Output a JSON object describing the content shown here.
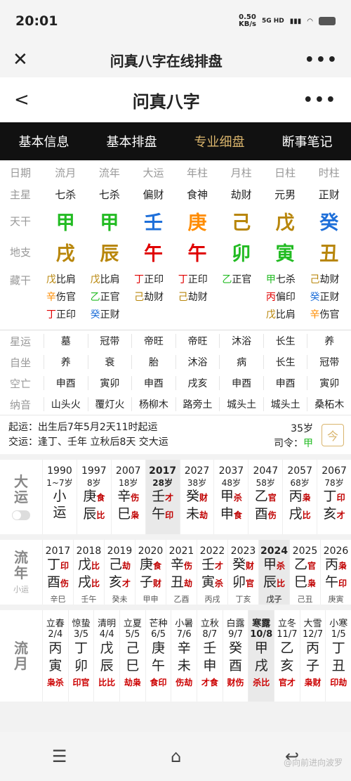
{
  "status": {
    "time": "20:01",
    "speed": "0.50",
    "speed_unit": "KB/s",
    "network": "5G HD"
  },
  "browser": {
    "title": "问真八字在线排盘"
  },
  "app": {
    "title": "问真八字"
  },
  "tabs": [
    {
      "label": "基本信息"
    },
    {
      "label": "基本排盘"
    },
    {
      "label": "专业细盘"
    },
    {
      "label": "断事笔记"
    }
  ],
  "colors": {
    "wood": "#22bb22",
    "fire": "#e00000",
    "earth": "#b8860b",
    "metal": "#ff8c00",
    "water": "#1e6fd9",
    "tag": "#c00000",
    "accent": "#d9b46c"
  },
  "chart": {
    "headers": {
      "label": "日期",
      "cols": [
        "流月",
        "流年",
        "大运",
        "年柱",
        "月柱",
        "日柱",
        "时柱"
      ]
    },
    "stars": {
      "label": "主星",
      "cols": [
        "七杀",
        "七杀",
        "偏财",
        "食神",
        "劫财",
        "元男",
        "正财"
      ]
    },
    "tiangan": {
      "label": "天干",
      "cols": [
        {
          "t": "甲",
          "c": "#22bb22"
        },
        {
          "t": "甲",
          "c": "#22bb22"
        },
        {
          "t": "壬",
          "c": "#1e6fd9"
        },
        {
          "t": "庚",
          "c": "#ff8c00"
        },
        {
          "t": "己",
          "c": "#b8860b"
        },
        {
          "t": "戊",
          "c": "#b8860b"
        },
        {
          "t": "癸",
          "c": "#1e6fd9"
        }
      ]
    },
    "dizhi": {
      "label": "地支",
      "cols": [
        {
          "t": "戌",
          "c": "#b8860b"
        },
        {
          "t": "辰",
          "c": "#b8860b"
        },
        {
          "t": "午",
          "c": "#e00000"
        },
        {
          "t": "午",
          "c": "#e00000"
        },
        {
          "t": "卯",
          "c": "#22bb22"
        },
        {
          "t": "寅",
          "c": "#22bb22"
        },
        {
          "t": "丑",
          "c": "#b8860b"
        }
      ]
    },
    "canggan": {
      "label": "藏干",
      "cols": [
        [
          {
            "g": "戊",
            "c": "#b8860b",
            "s": "比肩"
          },
          {
            "g": "辛",
            "c": "#ff8c00",
            "s": "伤官"
          },
          {
            "g": "丁",
            "c": "#e00000",
            "s": "正印"
          }
        ],
        [
          {
            "g": "戊",
            "c": "#b8860b",
            "s": "比肩"
          },
          {
            "g": "乙",
            "c": "#22bb22",
            "s": "正官"
          },
          {
            "g": "癸",
            "c": "#1e6fd9",
            "s": "正财"
          }
        ],
        [
          {
            "g": "丁",
            "c": "#e00000",
            "s": "正印"
          },
          {
            "g": "己",
            "c": "#b8860b",
            "s": "劫财"
          }
        ],
        [
          {
            "g": "丁",
            "c": "#e00000",
            "s": "正印"
          },
          {
            "g": "己",
            "c": "#b8860b",
            "s": "劫财"
          }
        ],
        [
          {
            "g": "乙",
            "c": "#22bb22",
            "s": "正官"
          }
        ],
        [
          {
            "g": "甲",
            "c": "#22bb22",
            "s": "七杀"
          },
          {
            "g": "丙",
            "c": "#e00000",
            "s": "偏印"
          },
          {
            "g": "戊",
            "c": "#b8860b",
            "s": "比肩"
          }
        ],
        [
          {
            "g": "己",
            "c": "#b8860b",
            "s": "劫财"
          },
          {
            "g": "癸",
            "c": "#1e6fd9",
            "s": "正财"
          },
          {
            "g": "辛",
            "c": "#ff8c00",
            "s": "伤官"
          }
        ]
      ]
    },
    "xingyun": {
      "label": "星运",
      "cols": [
        "墓",
        "冠带",
        "帝旺",
        "帝旺",
        "沐浴",
        "长生",
        "养"
      ]
    },
    "zizuo": {
      "label": "自坐",
      "cols": [
        "养",
        "衰",
        "胎",
        "沐浴",
        "病",
        "长生",
        "冠带"
      ]
    },
    "kongwang": {
      "label": "空亡",
      "cols": [
        "申酉",
        "寅卯",
        "申酉",
        "戌亥",
        "申酉",
        "申酉",
        "寅卯"
      ]
    },
    "nayin": {
      "label": "纳音",
      "cols": [
        "山头火",
        "覆灯火",
        "杨柳木",
        "路旁土",
        "城头土",
        "城头土",
        "桑柘木"
      ]
    }
  },
  "qiyun": {
    "line1": "起运：出生后7年5月2天11时起运",
    "line2": "交运：逢丁、壬年 立秋后8天 交大运",
    "age": "35岁",
    "siling_label": "司令：",
    "siling_value": "甲",
    "cal_icon": "今"
  },
  "dayun": {
    "label1": "大",
    "label2": "运",
    "items": [
      {
        "year": "1990",
        "age": "1~7岁",
        "xiao": [
          "小",
          "运"
        ]
      },
      {
        "year": "1997",
        "age": "8岁",
        "g": "庚",
        "gt": "食",
        "z": "辰",
        "zt": "比"
      },
      {
        "year": "2007",
        "age": "18岁",
        "g": "辛",
        "gt": "伤",
        "z": "巳",
        "zt": "枭"
      },
      {
        "year": "2017",
        "age": "28岁",
        "g": "壬",
        "gt": "才",
        "z": "午",
        "zt": "印",
        "hl": true
      },
      {
        "year": "2027",
        "age": "38岁",
        "g": "癸",
        "gt": "财",
        "z": "未",
        "zt": "劫"
      },
      {
        "year": "2037",
        "age": "48岁",
        "g": "甲",
        "gt": "杀",
        "z": "申",
        "zt": "食"
      },
      {
        "year": "2047",
        "age": "58岁",
        "g": "乙",
        "gt": "官",
        "z": "酉",
        "zt": "伤"
      },
      {
        "year": "2057",
        "age": "68岁",
        "g": "丙",
        "gt": "枭",
        "z": "戌",
        "zt": "比"
      },
      {
        "year": "2067",
        "age": "78岁",
        "g": "丁",
        "gt": "印",
        "z": "亥",
        "zt": "才"
      }
    ]
  },
  "liunian": {
    "label1": "流",
    "label2": "年",
    "sub": "小运",
    "items": [
      {
        "year": "2017",
        "g": "丁",
        "gt": "印",
        "z": "酉",
        "zt": "伤",
        "xy": "辛巳"
      },
      {
        "year": "2018",
        "g": "戊",
        "gt": "比",
        "z": "戌",
        "zt": "比",
        "xy": "壬午"
      },
      {
        "year": "2019",
        "g": "己",
        "gt": "劫",
        "z": "亥",
        "zt": "才",
        "xy": "癸未"
      },
      {
        "year": "2020",
        "g": "庚",
        "gt": "食",
        "z": "子",
        "zt": "财",
        "xy": "甲申"
      },
      {
        "year": "2021",
        "g": "辛",
        "gt": "伤",
        "z": "丑",
        "zt": "劫",
        "xy": "乙酉"
      },
      {
        "year": "2022",
        "g": "壬",
        "gt": "才",
        "z": "寅",
        "zt": "杀",
        "xy": "丙戌"
      },
      {
        "year": "2023",
        "g": "癸",
        "gt": "财",
        "z": "卯",
        "zt": "官",
        "xy": "丁亥"
      },
      {
        "year": "2024",
        "g": "甲",
        "gt": "杀",
        "z": "辰",
        "zt": "比",
        "xy": "戊子",
        "hl": true
      },
      {
        "year": "2025",
        "g": "乙",
        "gt": "官",
        "z": "巳",
        "zt": "枭",
        "xy": "己丑"
      },
      {
        "year": "2026",
        "g": "丙",
        "gt": "枭",
        "z": "午",
        "zt": "印",
        "xy": "庚寅"
      }
    ]
  },
  "liuyue": {
    "label1": "流",
    "label2": "月",
    "items": [
      {
        "jq": "立春",
        "d": "2/4",
        "g": "丙",
        "z": "寅",
        "p": "枭杀"
      },
      {
        "jq": "惊蛰",
        "d": "3/5",
        "g": "丁",
        "z": "卯",
        "p": "印官"
      },
      {
        "jq": "清明",
        "d": "4/4",
        "g": "戊",
        "z": "辰",
        "p": "比比"
      },
      {
        "jq": "立夏",
        "d": "5/5",
        "g": "己",
        "z": "巳",
        "p": "劫枭"
      },
      {
        "jq": "芒种",
        "d": "6/5",
        "g": "庚",
        "z": "午",
        "p": "食印"
      },
      {
        "jq": "小暑",
        "d": "7/6",
        "g": "辛",
        "z": "未",
        "p": "伤劫"
      },
      {
        "jq": "立秋",
        "d": "8/7",
        "g": "壬",
        "z": "申",
        "p": "才食"
      },
      {
        "jq": "白露",
        "d": "9/7",
        "g": "癸",
        "z": "酉",
        "p": "财伤"
      },
      {
        "jq": "寒露",
        "d": "10/8",
        "g": "甲",
        "z": "戌",
        "p": "杀比",
        "hl": true
      },
      {
        "jq": "立冬",
        "d": "11/7",
        "g": "乙",
        "z": "亥",
        "p": "官才"
      },
      {
        "jq": "大雪",
        "d": "12/7",
        "g": "丙",
        "z": "子",
        "p": "枭财"
      },
      {
        "jq": "小寒",
        "d": "1/5",
        "g": "丁",
        "z": "丑",
        "p": "印劫"
      }
    ]
  },
  "watermark": "@向前进向波罗"
}
